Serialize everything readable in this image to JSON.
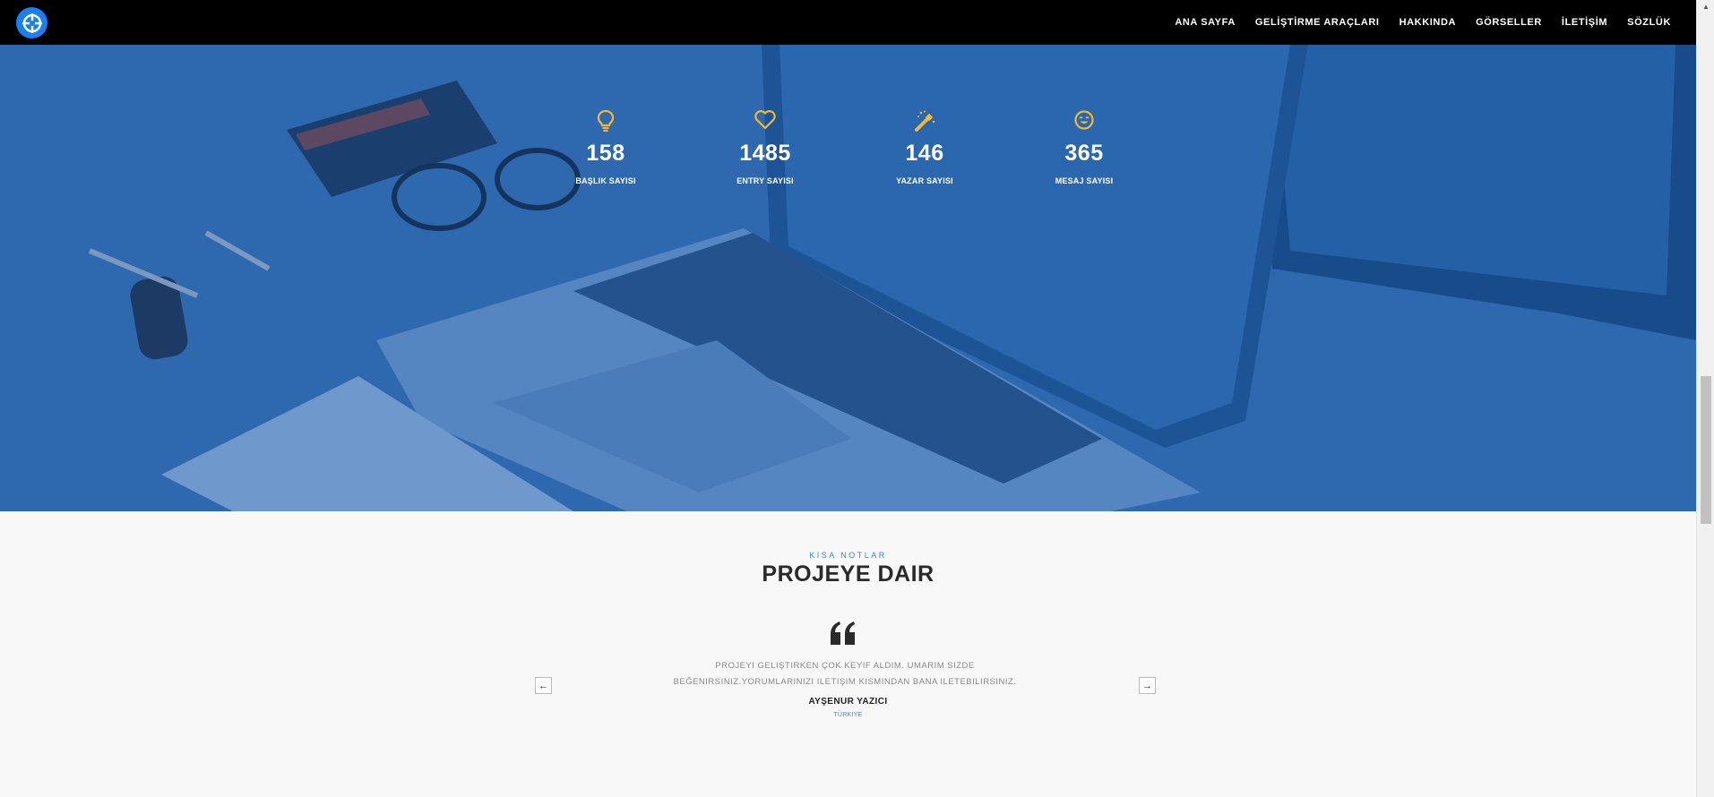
{
  "nav": {
    "logo_icon": "crosshair-logo-icon",
    "items": [
      {
        "label": "ANA SAYFA"
      },
      {
        "label": "GELİŞTİRME ARAÇLARI"
      },
      {
        "label": "HAKKINDA"
      },
      {
        "label": "GÖRSELLER"
      },
      {
        "label": "İLETİŞİM"
      },
      {
        "label": "SÖZLÜK"
      }
    ]
  },
  "stats": [
    {
      "icon": "lightbulb-icon",
      "value": "158",
      "label": "BAŞLIK SAYISI"
    },
    {
      "icon": "heart-icon",
      "value": "1485",
      "label": "ENTRY SAYISI"
    },
    {
      "icon": "magic-wand-icon",
      "value": "146",
      "label": "YAZAR SAYISI"
    },
    {
      "icon": "smiley-icon",
      "value": "365",
      "label": "MESAJ SAYISI"
    }
  ],
  "notes": {
    "subtitle": "KISA NOTLAR",
    "title": "PROJEYE DAIR",
    "quote_line1": "PROJEYI GELIŞTIRKEN ÇOK KEYIF ALDIM. UMARIM SIZDE",
    "quote_line2": "BEĞENIRSINIZ.YORUMLARINIZI ILETIŞIM KISMINDAN BANA ILETEBILIRSINIZ.",
    "author": "AYŞENUR YAZICI",
    "country": "TÜRKIYE",
    "prev_label": "←",
    "next_label": "→"
  },
  "colors": {
    "accent": "#3b86d8",
    "icon_yellow": "#f5b82e",
    "nav_bg": "#000000",
    "hero_blue": "#2d66ad"
  }
}
